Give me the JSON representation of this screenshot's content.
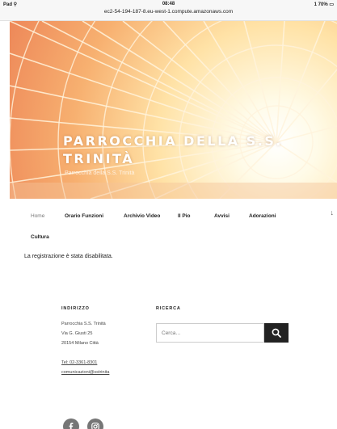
{
  "status_bar": {
    "left": "Pad ⚲",
    "time": "08:48",
    "url": "ec2-54-194-187-8.eu-west-1.compute.amazonaws.com",
    "right": "1 70% ▭"
  },
  "header": {
    "site_title": "Parrocchia della S.S. Trinità",
    "tagline": "Parrocchia della S.S. Trinità"
  },
  "nav": {
    "items": [
      {
        "label": "Home"
      },
      {
        "label": "Orario Funzioni"
      },
      {
        "label": "Archivio Video"
      },
      {
        "label": "Il Pio"
      },
      {
        "label": "Avvisi"
      },
      {
        "label": "Adorazioni"
      },
      {
        "label": "Cultura"
      }
    ],
    "more_icon": "arrow-down-icon"
  },
  "main": {
    "notice": "La registrazione è stata disabilitata."
  },
  "footer": {
    "address": {
      "title": "Indirizzo",
      "lines": [
        "Parrocchia S.S. Trinità",
        "Via G. Giusti 25",
        "20154 Milano Città"
      ],
      "phone": "Tel: 02-3361-8301",
      "email": "comunicazioni@sstrinita"
    },
    "search": {
      "title": "Ricerca",
      "placeholder": "Cerca…",
      "button_icon": "search-icon"
    },
    "social": [
      "facebook-icon",
      "instagram-icon"
    ]
  },
  "colors": {
    "banner_warm": "#f2a25c",
    "banner_light": "#fff5d8",
    "search_button": "#222222",
    "social_bg": "#767676"
  }
}
